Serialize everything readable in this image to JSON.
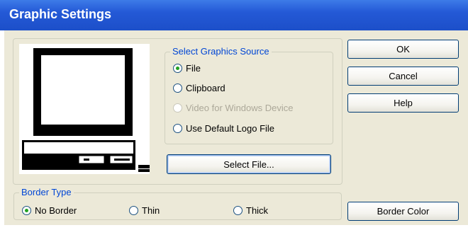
{
  "window": {
    "title": "Graphic Settings"
  },
  "graphics_source": {
    "legend": "Select Graphics Source",
    "options": [
      {
        "label": "File",
        "checked": true,
        "disabled": false
      },
      {
        "label": "Clipboard",
        "checked": false,
        "disabled": false
      },
      {
        "label": "Video for Windows Device",
        "checked": false,
        "disabled": true
      },
      {
        "label": "Use Default Logo File",
        "checked": false,
        "disabled": false
      }
    ]
  },
  "buttons": {
    "select_file": "Select File...",
    "ok": "OK",
    "cancel": "Cancel",
    "help": "Help",
    "border_color": "Border Color"
  },
  "border_type": {
    "legend": "Border Type",
    "options": [
      {
        "label": "No Border",
        "checked": true
      },
      {
        "label": "Thin",
        "checked": false
      },
      {
        "label": "Thick",
        "checked": false
      }
    ]
  },
  "colors": {
    "accent": "#2459d6",
    "legend_text": "#0046d5",
    "dialog_bg": "#ece9d8"
  },
  "icons": {
    "preview": "computer-icon"
  }
}
